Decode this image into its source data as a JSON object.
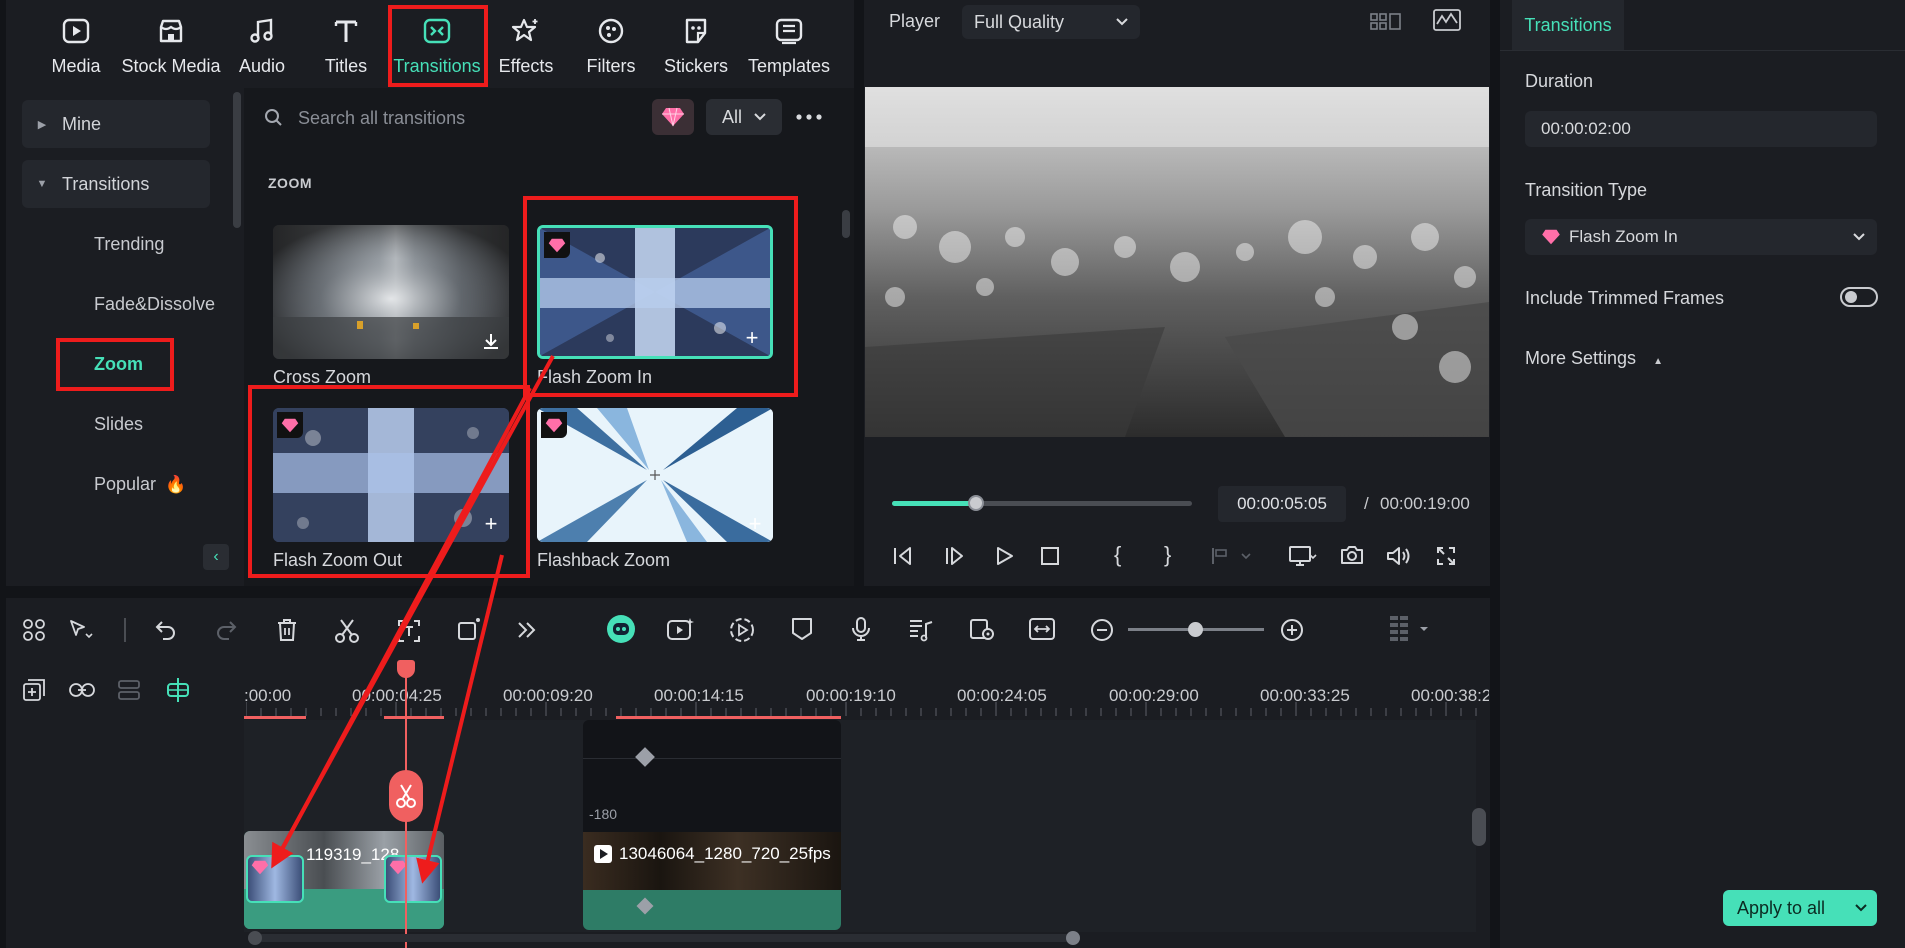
{
  "toolbar": {
    "tabs": [
      {
        "label": "Media",
        "icon": "media-icon"
      },
      {
        "label": "Stock Media",
        "icon": "stock-media-icon"
      },
      {
        "label": "Audio",
        "icon": "audio-icon"
      },
      {
        "label": "Titles",
        "icon": "titles-icon"
      },
      {
        "label": "Transitions",
        "icon": "transitions-icon",
        "active": true
      },
      {
        "label": "Effects",
        "icon": "effects-icon"
      },
      {
        "label": "Filters",
        "icon": "filters-icon"
      },
      {
        "label": "Stickers",
        "icon": "stickers-icon"
      },
      {
        "label": "Templates",
        "icon": "templates-icon"
      }
    ]
  },
  "sidebar": {
    "mine": "Mine",
    "transitions": "Transitions",
    "items": [
      "Trending",
      "Fade&Dissolve",
      "Zoom",
      "Slides",
      "Popular"
    ],
    "active_item": "Zoom"
  },
  "browser": {
    "search_placeholder": "Search all transitions",
    "filter": "All",
    "section": "ZOOM",
    "cards": [
      {
        "name": "Cross Zoom",
        "premium": false,
        "action": "download"
      },
      {
        "name": "Flash Zoom In",
        "premium": true,
        "action": "add",
        "selected": true
      },
      {
        "name": "Flash Zoom Out",
        "premium": true,
        "action": "add"
      },
      {
        "name": "Flashback Zoom",
        "premium": true,
        "action": "add"
      }
    ]
  },
  "player": {
    "label": "Player",
    "quality": "Full Quality",
    "current_time": "00:00:05:05",
    "separator": "/",
    "total_time": "00:00:19:00",
    "progress": 0.28
  },
  "properties": {
    "tab": "Transitions",
    "duration_label": "Duration",
    "duration_value": "00:00:02:00",
    "type_label": "Transition Type",
    "type_value": "Flash Zoom In",
    "trim_label": "Include Trimmed Frames",
    "trim_on": false,
    "more_label": "More Settings",
    "apply_label": "Apply to all"
  },
  "timeline": {
    "ticks": [
      ":00:00",
      "00:00:04:25",
      "00:00:09:20",
      "00:00:14:15",
      "00:00:19:10",
      "00:00:24:05",
      "00:00:29:00",
      "00:00:33:25",
      "00:00:38:2"
    ],
    "clip1_name": "119319_128",
    "clip2_name": "13046064_1280_720_25fps",
    "clip2_value": "-180"
  },
  "colors": {
    "accent": "#46e0b8",
    "highlight": "#ee1c1c",
    "playhead": "#f06060",
    "premium": "#ff6fa8"
  }
}
